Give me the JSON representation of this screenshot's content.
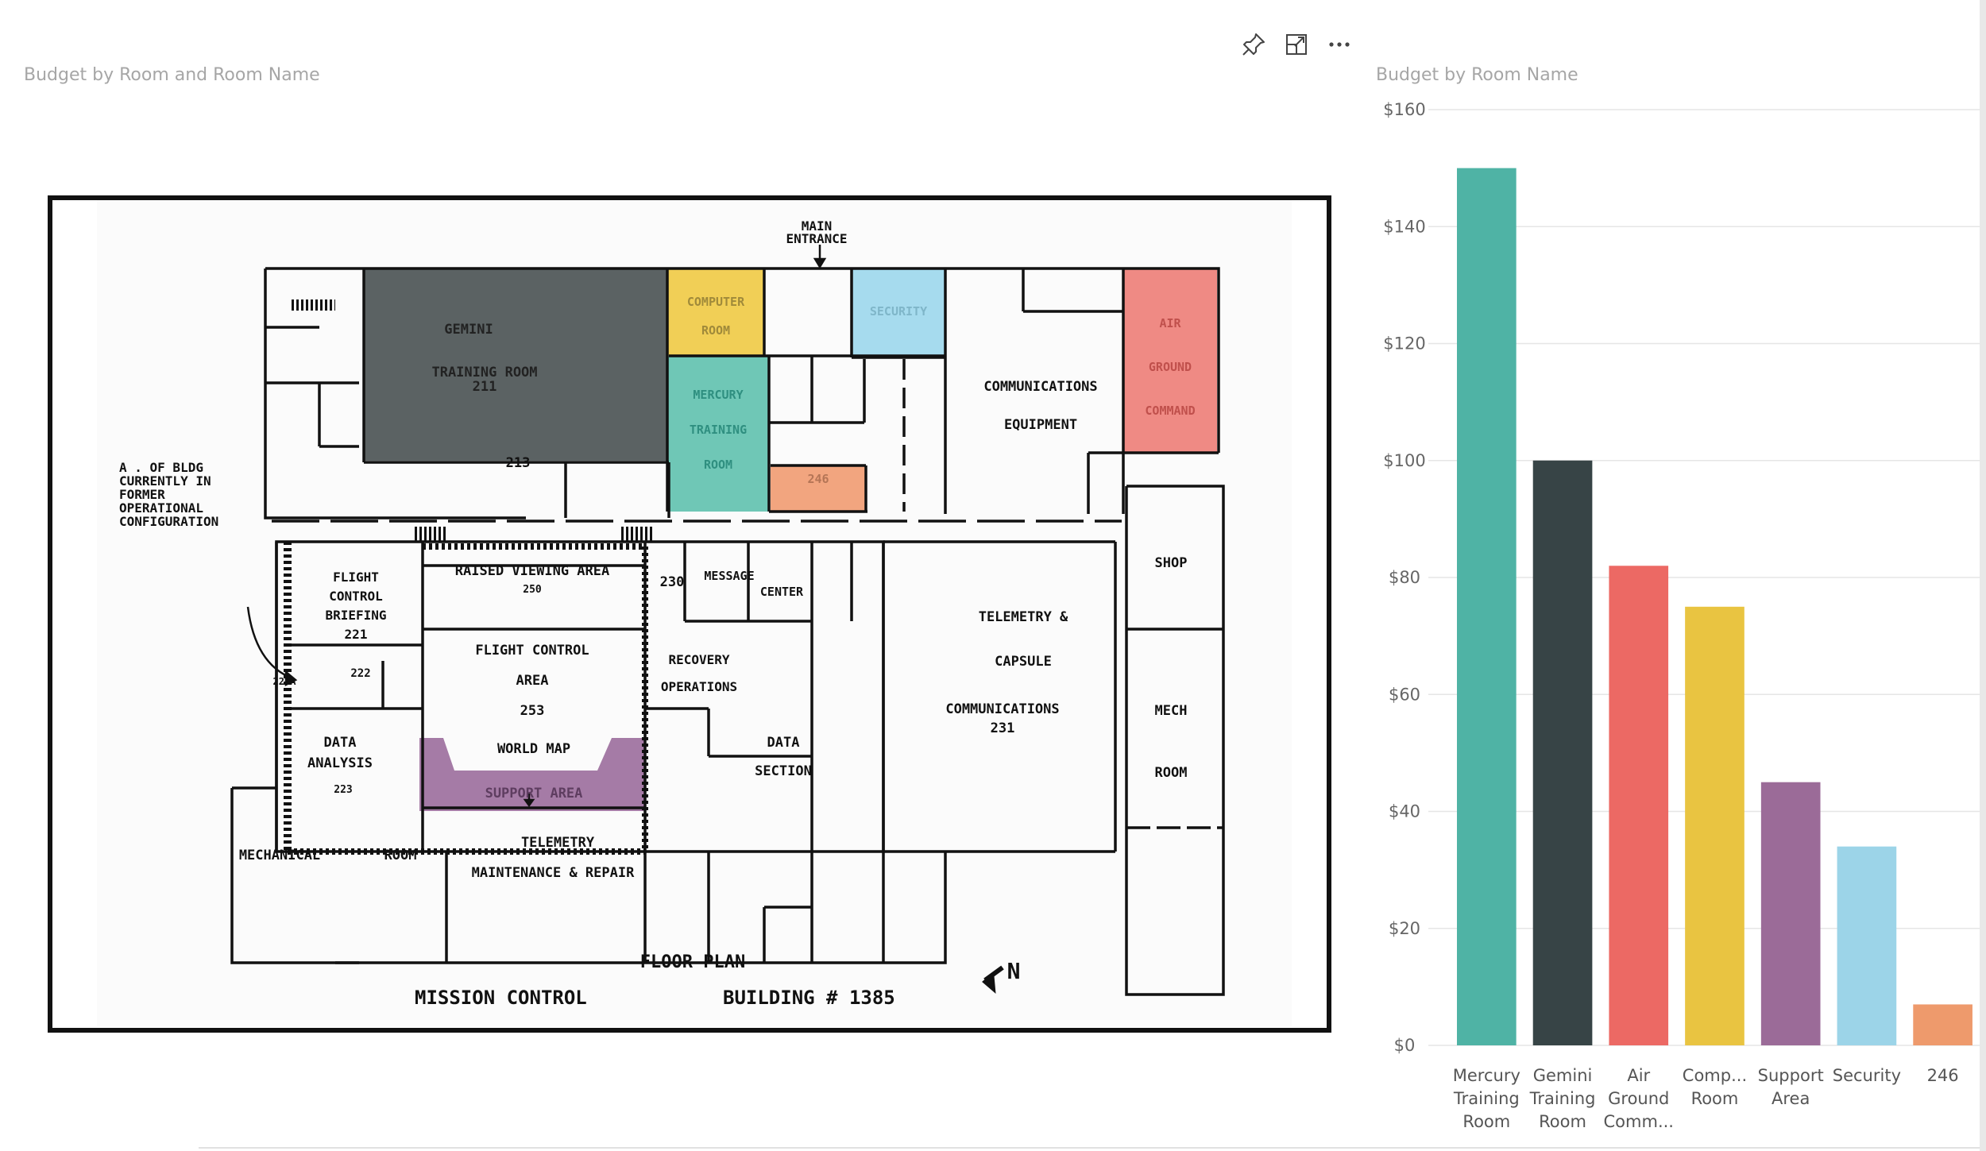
{
  "left_visual": {
    "title": "Budget by Room and Room Name"
  },
  "toolbar": {
    "pin_icon": "pin-icon",
    "focus_icon": "focus-mode-icon",
    "more_icon": "more-options-icon"
  },
  "floor_plan": {
    "caption_title": "FLOOR PLAN",
    "caption_left": "MISSION CONTROL",
    "caption_right": "BUILDING # 1385",
    "main_entrance": [
      "MAIN",
      "ENTRANCE"
    ],
    "note": [
      "A   . OF BLDG",
      "CURRENTLY IN",
      "FORMER",
      "OPERATIONAL",
      "CONFIGURATION"
    ],
    "north": "N",
    "rooms": {
      "gemini": [
        "GEMINI",
        "TRAINING     ROOM",
        "211"
      ],
      "computer": [
        "COMPUTER",
        "ROOM"
      ],
      "security": "SECURITY",
      "air_ground": [
        "AIR",
        "GROUND",
        "COMMAND"
      ],
      "mercury": [
        "MERCURY",
        "TRAINING",
        "ROOM"
      ],
      "r246": "246",
      "r213": "213",
      "comm_equip": [
        "COMMUNICATIONS",
        "EQUIPMENT"
      ],
      "shop": "SHOP",
      "raised": [
        "RAISED  VIEWING  AREA",
        "250"
      ],
      "r230": "230",
      "message": [
        "MESSAGE",
        "CENTER"
      ],
      "fcb": [
        "FLIGHT",
        "CONTROL",
        "BRIEFING",
        "221"
      ],
      "r222": "222",
      "r221a": "221A",
      "fca": [
        "FLIGHT  CONTROL",
        "AREA",
        "253"
      ],
      "recovery": [
        "RECOVERY",
        "OPERATIONS"
      ],
      "telemetry_capsule": [
        "TELEMETRY  &",
        "CAPSULE",
        "COMMUNICATIONS",
        "231"
      ],
      "mech": [
        "MECH",
        "ROOM"
      ],
      "data_analysis": [
        "DATA",
        "ANALYSIS",
        "223"
      ],
      "world_map": "WORLD   MAP",
      "support": "SUPPORT   AREA",
      "data_section": [
        "DATA",
        "SECTION"
      ],
      "mechanical": [
        "MECHANICAL",
        "ROOM"
      ],
      "tmr": [
        "TELEMETRY",
        "MAINTENANCE   &   REPAIR"
      ]
    },
    "colors": {
      "gemini": "#5b6263",
      "computer": "#f1cf56",
      "security": "#a6dbee",
      "air_ground": "#ef8a84",
      "mercury": "#6fc7b6",
      "r246": "#f2a57f",
      "support": "#a57ba6"
    }
  },
  "right_visual": {
    "title": "Budget by Room Name"
  },
  "chart_data": {
    "type": "bar",
    "title": "Budget by Room Name",
    "categories": [
      [
        "Mercury",
        "Training",
        "Room"
      ],
      [
        "Gemini",
        "Training",
        "Room"
      ],
      [
        "Air",
        "Ground",
        "Comm..."
      ],
      [
        "Comp...",
        "Room"
      ],
      [
        "Support",
        "Area"
      ],
      [
        "Security"
      ],
      [
        "246"
      ]
    ],
    "values": [
      150,
      100,
      82,
      75,
      45,
      34,
      7
    ],
    "colors": [
      "#4fb3a5",
      "#374446",
      "#ec6964",
      "#e9c441",
      "#9b6b98",
      "#9cd4e8",
      "#ee9a6c"
    ],
    "ylim": [
      0,
      160
    ],
    "yticks": [
      "$0",
      "$20",
      "$40",
      "$60",
      "$80",
      "$100",
      "$120",
      "$140",
      "$160"
    ],
    "xlabel": "",
    "ylabel": "",
    "grid": true
  }
}
